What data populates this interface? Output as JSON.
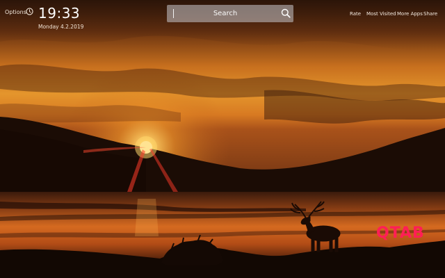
{
  "header": {
    "options_label": "Options",
    "time": "19:33",
    "date": "Monday 4.2.2019"
  },
  "search": {
    "placeholder": "Search"
  },
  "nav": {
    "items": [
      {
        "label": "Rate"
      },
      {
        "label": "Most Visited"
      },
      {
        "label": "More Apps"
      },
      {
        "label": "Share"
      }
    ]
  },
  "brand": {
    "logo_text": "QTAB",
    "logo_color": "#ff1e56"
  },
  "wallpaper": {
    "subject": "sunset-lake-deer-silhouette"
  }
}
